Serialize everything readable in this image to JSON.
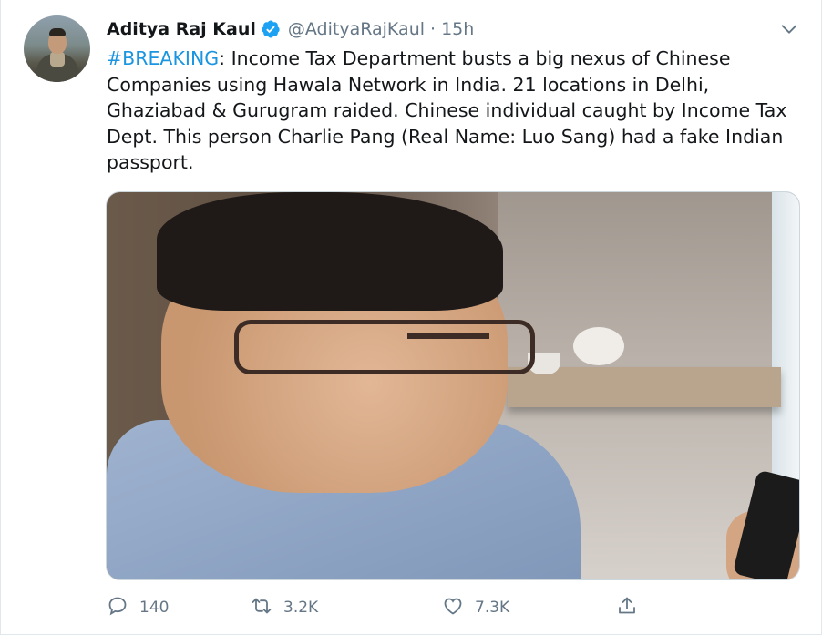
{
  "tweet": {
    "author_name": "Aditya Raj Kaul",
    "handle": "@AdityaRajKaul",
    "separator": "·",
    "time": "15h",
    "hashtag": "#BREAKING",
    "body": ": Income Tax Department busts a big nexus of Chinese Companies using Hawala Network in India. 21 locations in Delhi, Ghaziabad & Gurugram raided. Chinese individual caught by Income Tax Dept. This person Charlie Pang (Real Name: Luo Sang) had a fake Indian passport."
  },
  "actions": {
    "reply": {
      "icon": "reply-icon",
      "count": "140"
    },
    "retweet": {
      "icon": "retweet-icon",
      "count": "3.2K"
    },
    "like": {
      "icon": "heart-icon",
      "count": "7.3K"
    },
    "share": {
      "icon": "share-icon"
    }
  },
  "colors": {
    "link": "#1b95e0",
    "secondary_text": "#657786",
    "verified": "#1da1f2"
  }
}
